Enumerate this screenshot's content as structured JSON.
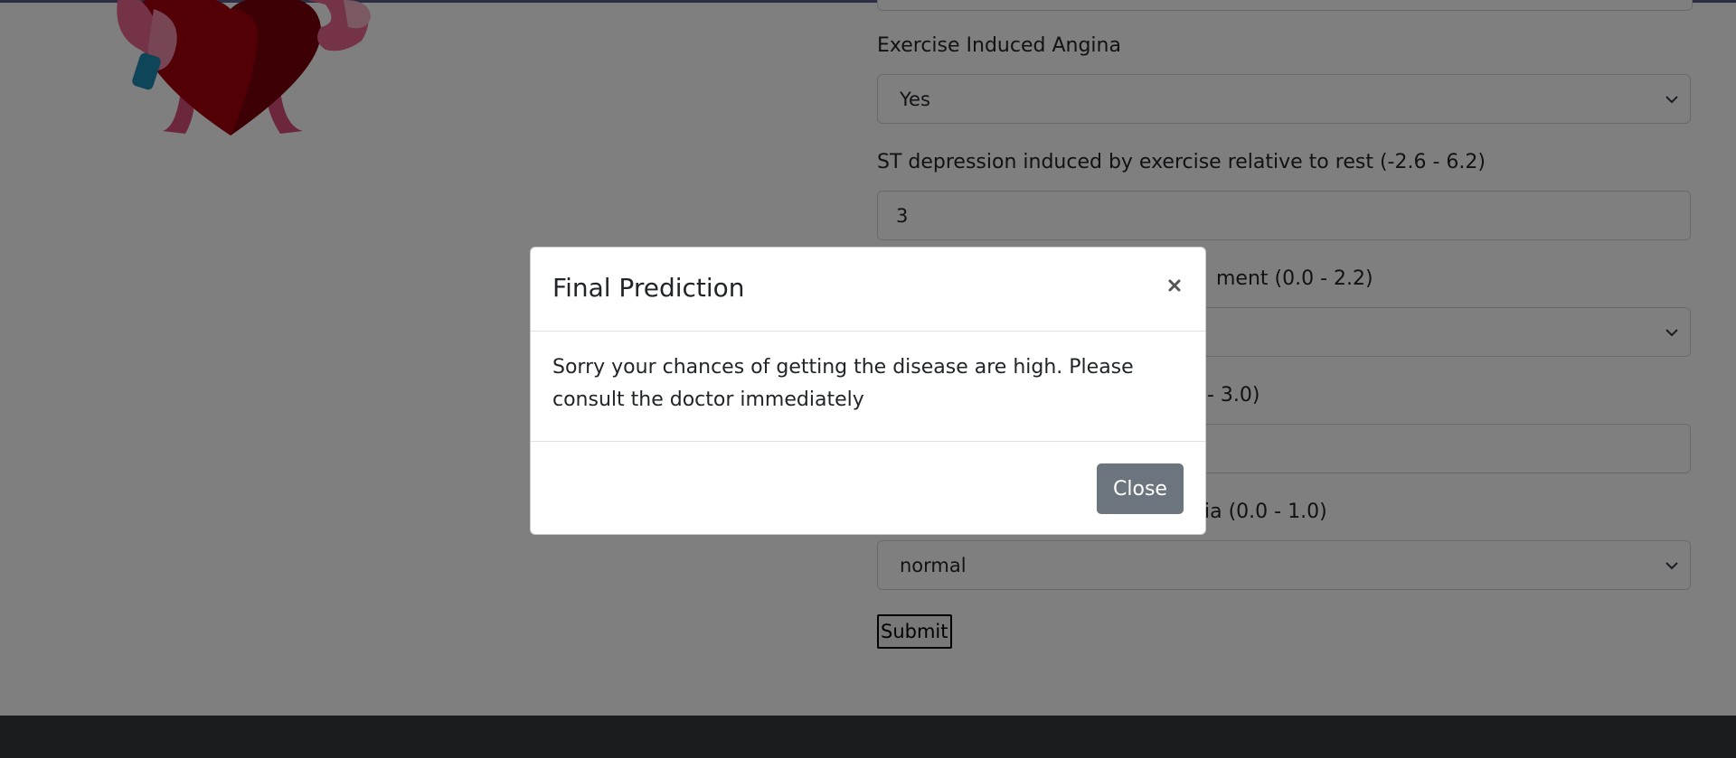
{
  "form": {
    "fields": [
      {
        "label": "Exercise Induced Angina",
        "type": "select",
        "value": "Yes"
      },
      {
        "label": "ST depression induced by exercise relative to rest (-2.6 - 6.2)",
        "type": "input",
        "value": "3"
      },
      {
        "label": "ment (0.0 - 2.2)",
        "type": "select",
        "value": ""
      },
      {
        "label": "- 3.0)",
        "type": "input",
        "value": ""
      },
      {
        "label": "ia (0.0 - 1.0)",
        "type": "select",
        "value": "normal"
      }
    ],
    "submit_label": "Submit"
  },
  "modal": {
    "title": "Final Prediction",
    "body": "Sorry your chances of getting the disease are high. Please consult the doctor immediately",
    "close_label": "Close",
    "close_icon": "close-icon"
  },
  "colors": {
    "backdrop": "rgba(0,0,0,0.5)",
    "footer": "#343a40",
    "close_button": "#6c757d",
    "heart": "#b3000c",
    "mascot_pink": "#f06292"
  }
}
